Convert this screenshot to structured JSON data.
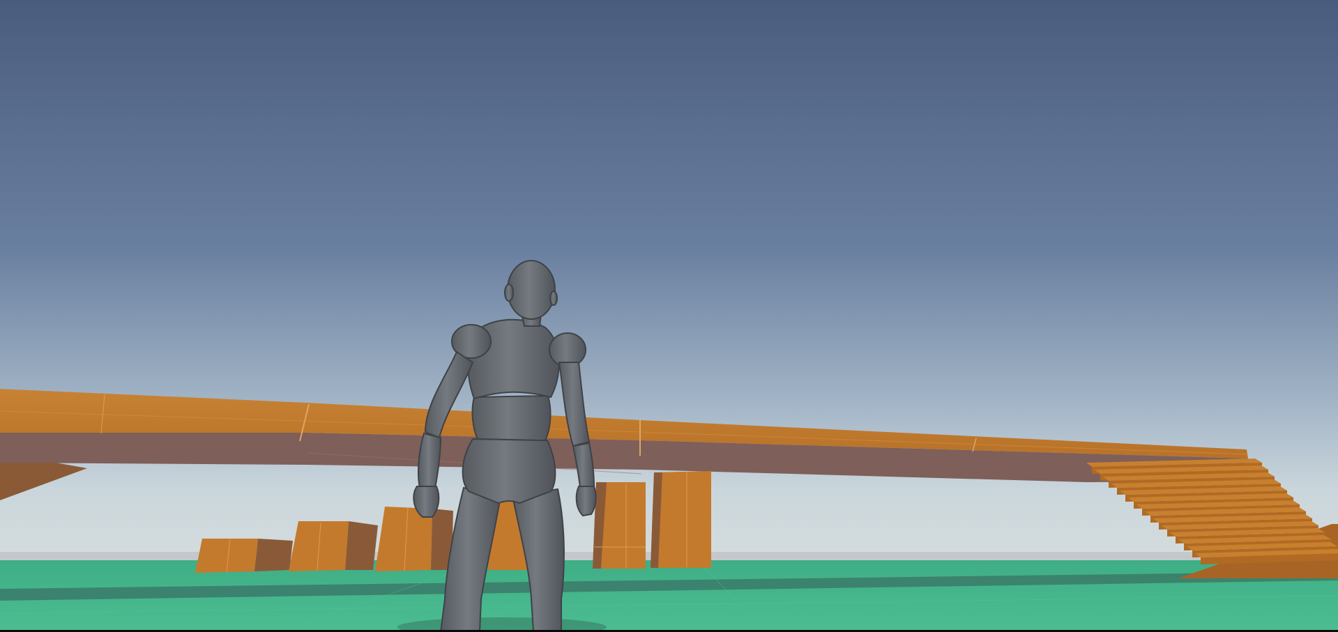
{
  "scene": {
    "kind": "3d-game-viewport",
    "colors": {
      "sky_top": "#4a5e80",
      "sky_horizon": "#c8d4dc",
      "ground": "#43b48a",
      "ground_shadow": "#3a7c6c",
      "platform_top": "#c47a2c",
      "platform_underside": "#7e5e58",
      "block": "#c47a2c",
      "block_side": "#8a5a34",
      "character": "#6a6e72",
      "character_shadow": "#4a4e52"
    },
    "objects": {
      "character": "mannequin-character",
      "bridge": "elevated-orange-platform",
      "blocks": "orange-box-obstacles",
      "stairs": "orange-staircase",
      "ground": "green-ground-plane"
    }
  }
}
